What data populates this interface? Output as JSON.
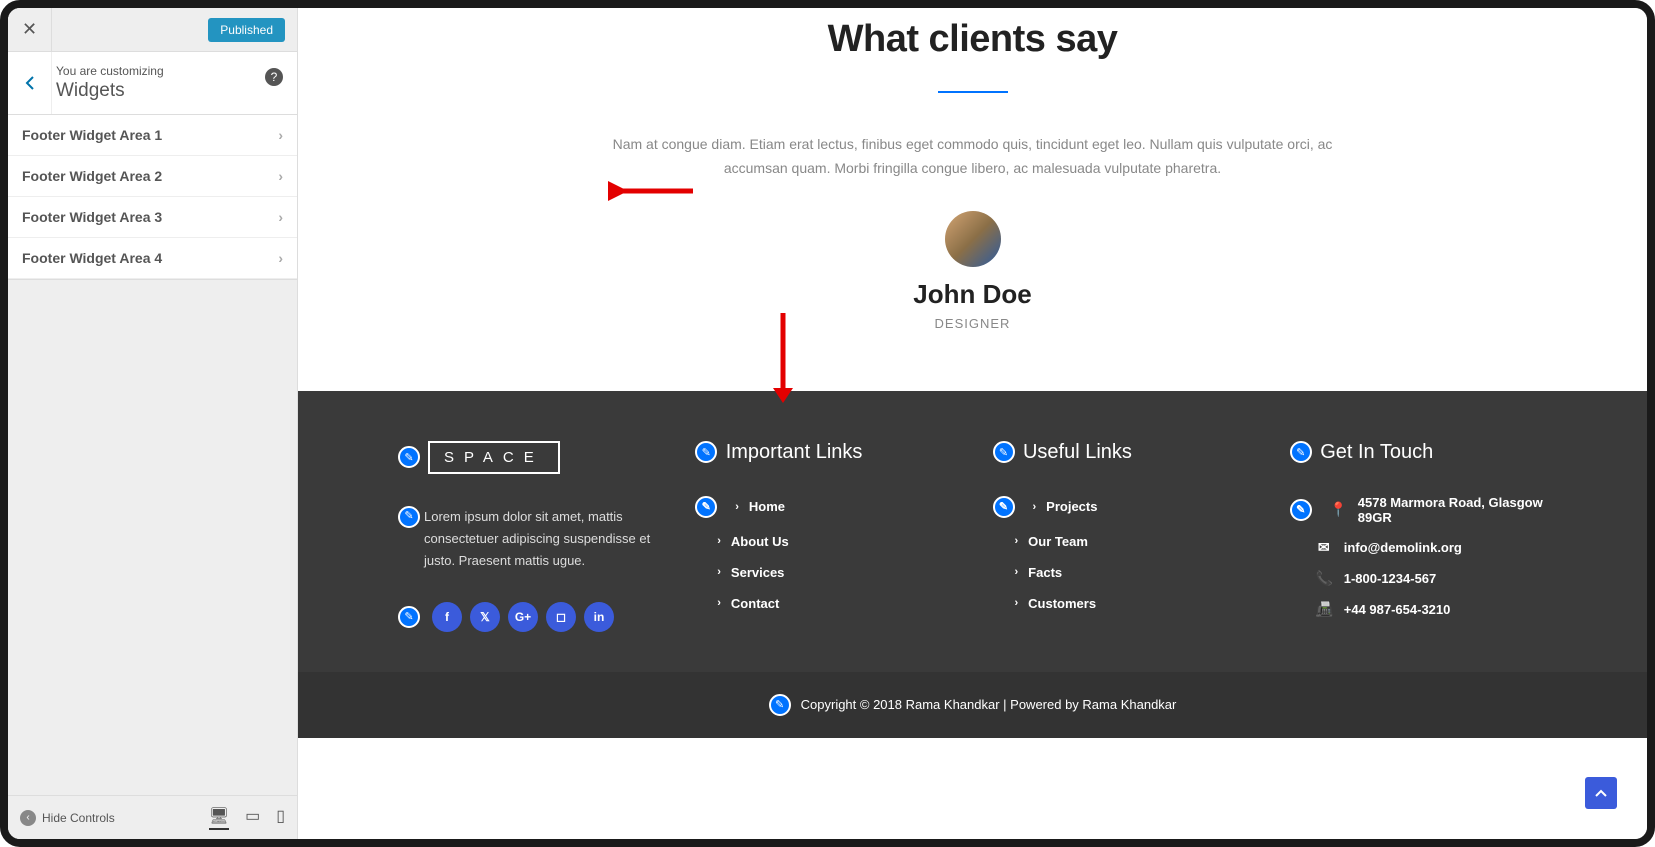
{
  "sidebar": {
    "published_label": "Published",
    "customizing_label": "You are customizing",
    "panel_title": "Widgets",
    "sections": [
      "Footer Widget Area 1",
      "Footer Widget Area 2",
      "Footer Widget Area 3",
      "Footer Widget Area 4"
    ],
    "hide_controls": "Hide Controls"
  },
  "testimonials": {
    "heading": "What clients say",
    "quote": "Nam at congue diam. Etiam erat lectus, finibus eget commodo quis, tincidunt eget leo. Nullam quis vulputate orci, ac accumsan quam. Morbi fringilla congue libero, ac malesuada vulputate pharetra.",
    "name": "John Doe",
    "role": "DESIGNER"
  },
  "footer": {
    "logo": "SPACE",
    "description": "Lorem ipsum dolor sit amet, mattis consectetuer adipiscing suspendisse et justo. Praesent mattis ugue.",
    "col2": {
      "title": "Important Links",
      "items": [
        "Home",
        "About Us",
        "Services",
        "Contact"
      ]
    },
    "col3": {
      "title": "Useful Links",
      "items": [
        "Projects",
        "Our Team",
        "Facts",
        "Customers"
      ]
    },
    "col4": {
      "title": "Get In Touch",
      "address": "4578 Marmora Road, Glasgow 89GR",
      "email": "info@demolink.org",
      "phone": "1-800-1234-567",
      "fax": "+44 987-654-3210"
    },
    "copyright": "Copyright © 2018 Rama Khandkar | Powered by Rama Khandkar"
  }
}
